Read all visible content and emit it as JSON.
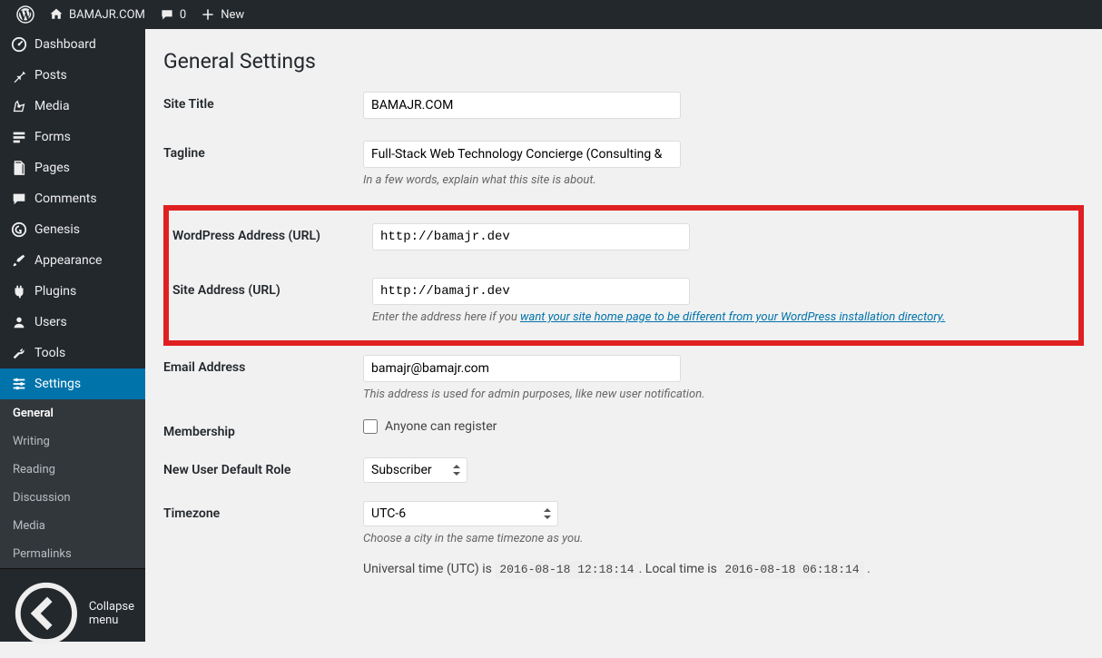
{
  "adminbar": {
    "site_name": "BAMAJR.COM",
    "comments_count": "0",
    "new_label": "New"
  },
  "sidebar": {
    "dashboard": "Dashboard",
    "posts": "Posts",
    "media": "Media",
    "forms": "Forms",
    "pages": "Pages",
    "comments": "Comments",
    "genesis": "Genesis",
    "appearance": "Appearance",
    "plugins": "Plugins",
    "users": "Users",
    "tools": "Tools",
    "settings": "Settings",
    "sub": {
      "general": "General",
      "writing": "Writing",
      "reading": "Reading",
      "discussion": "Discussion",
      "media": "Media",
      "permalinks": "Permalinks"
    },
    "collapse": "Collapse menu"
  },
  "page": {
    "title": "General Settings",
    "site_title": {
      "label": "Site Title",
      "value": "BAMAJR.COM"
    },
    "tagline": {
      "label": "Tagline",
      "value": "Full-Stack Web Technology Concierge (Consulting & ",
      "help": "In a few words, explain what this site is about."
    },
    "wp_url": {
      "label": "WordPress Address (URL)",
      "value": "http://bamajr.dev"
    },
    "site_url": {
      "label": "Site Address (URL)",
      "value": "http://bamajr.dev",
      "help_prefix": "Enter the address here if you ",
      "help_link": "want your site home page to be different from your WordPress installation directory."
    },
    "email": {
      "label": "Email Address",
      "value": "bamajr@bamajr.com",
      "help": "This address is used for admin purposes, like new user notification."
    },
    "membership": {
      "label": "Membership",
      "option": "Anyone can register"
    },
    "new_user_role": {
      "label": "New User Default Role",
      "selected": "Subscriber"
    },
    "timezone": {
      "label": "Timezone",
      "selected": "UTC-6",
      "help": "Choose a city in the same timezone as you.",
      "utc_prefix": "Universal time (UTC) is ",
      "utc_time": "2016-08-18 12:18:14",
      "local_prefix": ". Local time is ",
      "local_time": "2016-08-18 06:18:14",
      "suffix": " ."
    }
  }
}
